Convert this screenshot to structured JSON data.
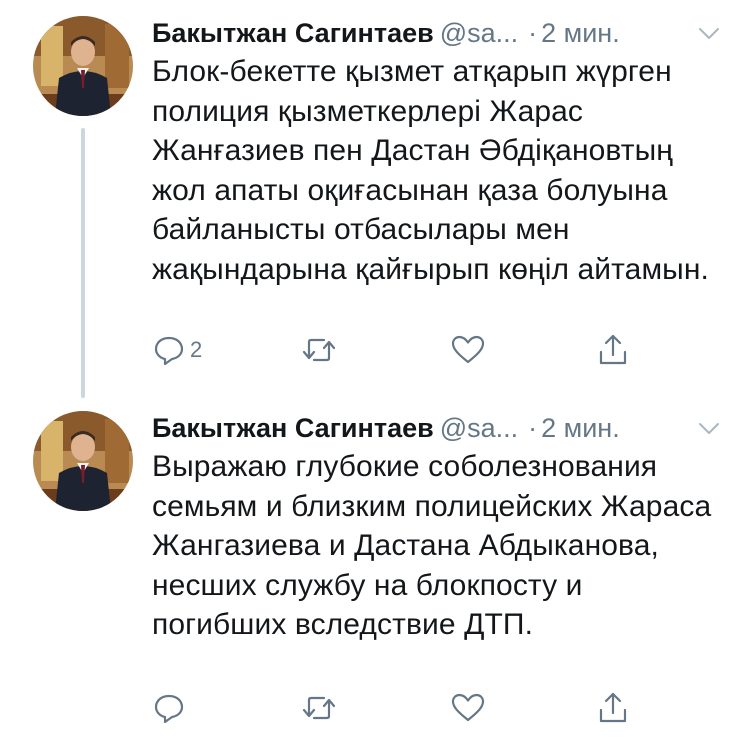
{
  "colors": {
    "text": "#14171a",
    "secondary": "#657786",
    "thread_line": "#ccd6dd"
  },
  "tweets": [
    {
      "author_name": "Бакытжан Сагинтаев",
      "handle": "@sa...",
      "separator": "·",
      "time": "2 мин.",
      "text": "Блок-бекетте қызмет атқарып жүрген полиция қызметкерлері Жарас Жанғазиев пен Дастан Әбдіқановтың жол апаты оқиғасынан қаза болуына байланысты отбасылары мен жақындарына қайғырып көңіл айтамын.",
      "reply_count": "2",
      "icons": [
        "reply-icon",
        "retweet-icon",
        "like-icon",
        "share-icon"
      ]
    },
    {
      "author_name": "Бакытжан Сагинтаев",
      "handle": "@sa...",
      "separator": "·",
      "time": "2 мин.",
      "text": "Выражаю глубокие соболезнования семьям и близким полицейских Жараса Жангазиева и Дастана Абдыканова, несших службу на блокпосту и погибших вследствие ДТП.",
      "reply_count": "",
      "icons": [
        "reply-icon",
        "retweet-icon",
        "like-icon",
        "share-icon"
      ]
    }
  ]
}
